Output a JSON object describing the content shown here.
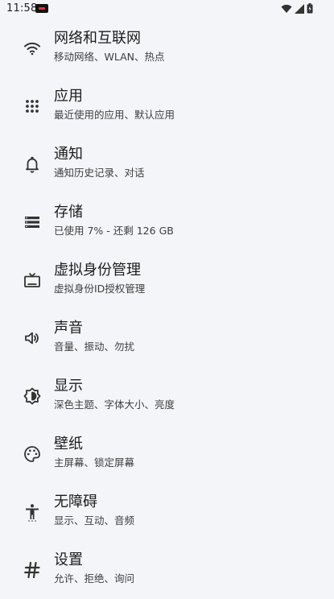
{
  "status_bar": {
    "time": "11:58",
    "icons": [
      "notification-icon",
      "wifi-icon",
      "cellular-signal-icon",
      "battery-icon"
    ]
  },
  "settings": {
    "items": [
      {
        "title": "网络和互联网",
        "subtitle": "移动网络、WLAN、热点",
        "icon": "wifi-icon"
      },
      {
        "title": "应用",
        "subtitle": "最近使用的应用、默认应用",
        "icon": "apps-grid-icon"
      },
      {
        "title": "通知",
        "subtitle": "通知历史记录、对话",
        "icon": "bell-icon"
      },
      {
        "title": "存储",
        "subtitle": "已使用 7% - 还剩 126 GB",
        "icon": "storage-icon"
      },
      {
        "title": "虚拟身份管理",
        "subtitle": "虚拟身份ID授权管理",
        "icon": "tv-icon"
      },
      {
        "title": "声音",
        "subtitle": "音量、振动、勿扰",
        "icon": "speaker-icon"
      },
      {
        "title": "显示",
        "subtitle": "深色主题、字体大小、亮度",
        "icon": "brightness-icon"
      },
      {
        "title": "壁纸",
        "subtitle": "主屏幕、锁定屏幕",
        "icon": "palette-icon"
      },
      {
        "title": "无障碍",
        "subtitle": "显示、互动、音频",
        "icon": "accessibility-icon"
      },
      {
        "title": "设置",
        "subtitle": "允许、拒绝、询问",
        "icon": "hash-icon"
      }
    ]
  }
}
